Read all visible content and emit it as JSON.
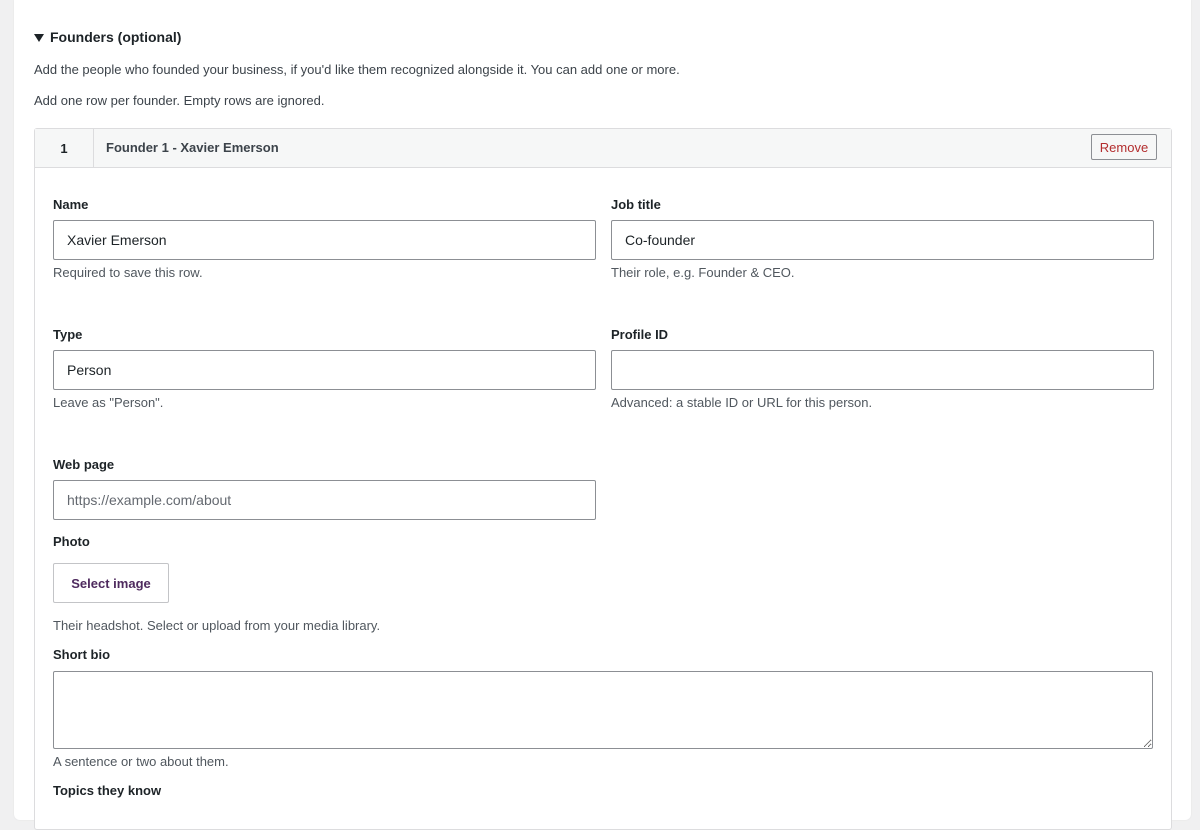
{
  "section": {
    "title": "Founders (optional)",
    "description": "Add the people who founded your business, if you'd like them recognized alongside it. You can add one or more.",
    "note": "Add one row per founder. Empty rows are ignored."
  },
  "row": {
    "number": "1",
    "title": "Founder 1 - Xavier Emerson",
    "remove_label": "Remove"
  },
  "fields": {
    "name": {
      "label": "Name",
      "value": "Xavier Emerson",
      "help": "Required to save this row."
    },
    "job_title": {
      "label": "Job title",
      "value": "Co-founder",
      "help": "Their role, e.g. Founder & CEO."
    },
    "type": {
      "label": "Type",
      "value": "Person",
      "help": "Leave as \"Person\"."
    },
    "profile_id": {
      "label": "Profile ID",
      "value": "",
      "help": "Advanced: a stable ID or URL for this person."
    },
    "web_page": {
      "label": "Web page",
      "value": "",
      "placeholder": "https://example.com/about"
    },
    "photo": {
      "label": "Photo",
      "button_label": "Select image",
      "help": "Their headshot. Select or upload from your media library."
    },
    "short_bio": {
      "label": "Short bio",
      "value": "",
      "help": "A sentence or two about them."
    },
    "topics": {
      "label": "Topics they know"
    }
  },
  "colors": {
    "remove_text": "#b32d2e",
    "select_image_text": "#4e2a5e",
    "page_background": "#f0f0f1"
  }
}
